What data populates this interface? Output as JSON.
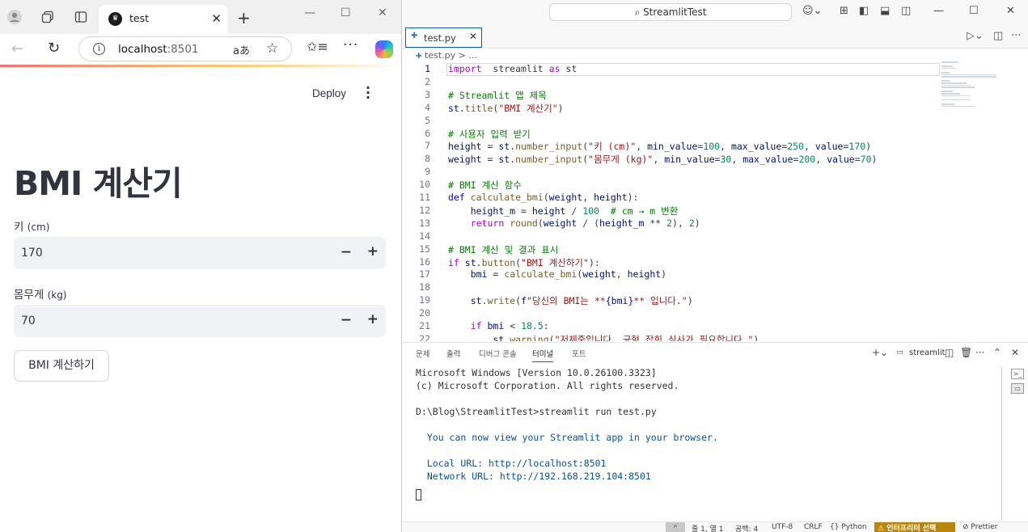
{
  "browser": {
    "tab_title": "test",
    "url_host": "localhost",
    "url_port": ":8501",
    "read_aloud": "aあ"
  },
  "app": {
    "deploy_label": "Deploy",
    "title": "BMI 계산기",
    "height_label": "키",
    "height_unit": "(cm)",
    "height_value": "170",
    "weight_label": "몸무게",
    "weight_unit": "(kg)",
    "weight_value": "70",
    "button_label": "BMI 계산하기"
  },
  "vscode": {
    "command_center": "StreamlitTest",
    "tab_title": "test.py",
    "breadcrumb_file": "test.py",
    "breadcrumb_rest": "> ...",
    "active_line": 1,
    "code_lines": [
      [
        [
          "k",
          "import"
        ],
        [
          "",
          "  streamlit "
        ],
        [
          "k",
          "as"
        ],
        [
          "",
          " st"
        ]
      ],
      [],
      [
        [
          "c",
          "# Streamlit 앱 제목"
        ]
      ],
      [
        [
          "v",
          "st"
        ],
        [
          "",
          "."
        ],
        [
          "f",
          "title"
        ],
        [
          "",
          "("
        ],
        [
          "s",
          "\"BMI 계산기\""
        ],
        [
          "",
          ")"
        ]
      ],
      [],
      [
        [
          "c",
          "# 사용자 입력 받기"
        ]
      ],
      [
        [
          "v",
          "height"
        ],
        [
          "",
          " = "
        ],
        [
          "v",
          "st"
        ],
        [
          "",
          "."
        ],
        [
          "f",
          "number_input"
        ],
        [
          "",
          "("
        ],
        [
          "s",
          "\"키 (cm)\""
        ],
        [
          "",
          ", "
        ],
        [
          "v",
          "min_value"
        ],
        [
          "",
          "="
        ],
        [
          "n",
          "100"
        ],
        [
          "",
          ", "
        ],
        [
          "v",
          "max_value"
        ],
        [
          "",
          "="
        ],
        [
          "n",
          "250"
        ],
        [
          "",
          ", "
        ],
        [
          "v",
          "value"
        ],
        [
          "",
          "="
        ],
        [
          "n",
          "170"
        ],
        [
          "",
          ")"
        ]
      ],
      [
        [
          "v",
          "weight"
        ],
        [
          "",
          " = "
        ],
        [
          "v",
          "st"
        ],
        [
          "",
          "."
        ],
        [
          "f",
          "number_input"
        ],
        [
          "",
          "("
        ],
        [
          "s",
          "\"몸무게 (kg)\""
        ],
        [
          "",
          ", "
        ],
        [
          "v",
          "min_value"
        ],
        [
          "",
          "="
        ],
        [
          "n",
          "30"
        ],
        [
          "",
          ", "
        ],
        [
          "v",
          "max_value"
        ],
        [
          "",
          "="
        ],
        [
          "n",
          "200"
        ],
        [
          "",
          ", "
        ],
        [
          "v",
          "value"
        ],
        [
          "",
          "="
        ],
        [
          "n",
          "70"
        ],
        [
          "",
          ")"
        ]
      ],
      [],
      [
        [
          "c",
          "# BMI 계산 함수"
        ]
      ],
      [
        [
          "kb",
          "def"
        ],
        [
          "",
          " "
        ],
        [
          "f",
          "calculate_bmi"
        ],
        [
          "",
          "("
        ],
        [
          "v",
          "weight"
        ],
        [
          "",
          ", "
        ],
        [
          "v",
          "height"
        ],
        [
          "",
          "):"
        ]
      ],
      [
        [
          "",
          "    "
        ],
        [
          "v",
          "height_m"
        ],
        [
          "",
          " = "
        ],
        [
          "v",
          "height"
        ],
        [
          "",
          " / "
        ],
        [
          "n",
          "100"
        ],
        [
          "",
          "  "
        ],
        [
          "c",
          "# cm → m 변환"
        ]
      ],
      [
        [
          "",
          "    "
        ],
        [
          "k",
          "return"
        ],
        [
          "",
          " "
        ],
        [
          "f",
          "round"
        ],
        [
          "",
          "("
        ],
        [
          "v",
          "weight"
        ],
        [
          "",
          " / ("
        ],
        [
          "v",
          "height_m"
        ],
        [
          "",
          " ** "
        ],
        [
          "n",
          "2"
        ],
        [
          "",
          "), "
        ],
        [
          "n",
          "2"
        ],
        [
          "",
          ")"
        ]
      ],
      [],
      [
        [
          "c",
          "# BMI 계산 및 결과 표시"
        ]
      ],
      [
        [
          "k",
          "if"
        ],
        [
          "",
          " "
        ],
        [
          "v",
          "st"
        ],
        [
          "",
          "."
        ],
        [
          "f",
          "button"
        ],
        [
          "",
          "("
        ],
        [
          "s",
          "\"BMI 계산하기\""
        ],
        [
          "",
          "):"
        ]
      ],
      [
        [
          "",
          "    "
        ],
        [
          "v",
          "bmi"
        ],
        [
          "",
          " = "
        ],
        [
          "f",
          "calculate_bmi"
        ],
        [
          "",
          "("
        ],
        [
          "v",
          "weight"
        ],
        [
          "",
          ", "
        ],
        [
          "v",
          "height"
        ],
        [
          "",
          ")"
        ]
      ],
      [],
      [
        [
          "",
          "    "
        ],
        [
          "v",
          "st"
        ],
        [
          "",
          "."
        ],
        [
          "f",
          "write"
        ],
        [
          "",
          "("
        ],
        [
          "kb",
          "f"
        ],
        [
          "s",
          "\"당신의 BMI는 **"
        ],
        [
          "kb",
          "{"
        ],
        [
          "v",
          "bmi"
        ],
        [
          "kb",
          "}"
        ],
        [
          "s",
          "** 입니다.\""
        ],
        [
          "",
          ")"
        ]
      ],
      [],
      [
        [
          "",
          "    "
        ],
        [
          "k",
          "if"
        ],
        [
          "",
          " "
        ],
        [
          "v",
          "bmi"
        ],
        [
          "",
          " < "
        ],
        [
          "n",
          "18.5"
        ],
        [
          "",
          ":"
        ]
      ],
      [
        [
          "",
          "        "
        ],
        [
          "v",
          "st"
        ],
        [
          "",
          "."
        ],
        [
          "f",
          "warning"
        ],
        [
          "",
          "("
        ],
        [
          "s",
          "\"저체중입니다. 균형 잡힌 식사가 필요합니다.\""
        ],
        [
          "",
          ")"
        ]
      ]
    ],
    "panel_tabs": [
      "문제",
      "출력",
      "디버그 콘솔",
      "터미널",
      "포트"
    ],
    "active_panel_tab": "터미널",
    "terminal_name": "streamlit",
    "terminal_lines": [
      "Microsoft Windows [Version 10.0.26100.3323]",
      "(c) Microsoft Corporation. All rights reserved.",
      "",
      "D:\\Blog\\StreamlitTest>streamlit run test.py",
      "",
      "  You can now view your Streamlit app in your browser.",
      "",
      "  Local URL: http://localhost:8501",
      "  Network URL: http://192.168.219.104:8501"
    ],
    "status": {
      "position": "줄 1, 열 1",
      "spaces": "공백: 4",
      "encoding": "UTF-8",
      "eol": "CRLF",
      "language": "Python",
      "interpreter": "인터프리터 선택",
      "formatter": "Prettier"
    }
  }
}
